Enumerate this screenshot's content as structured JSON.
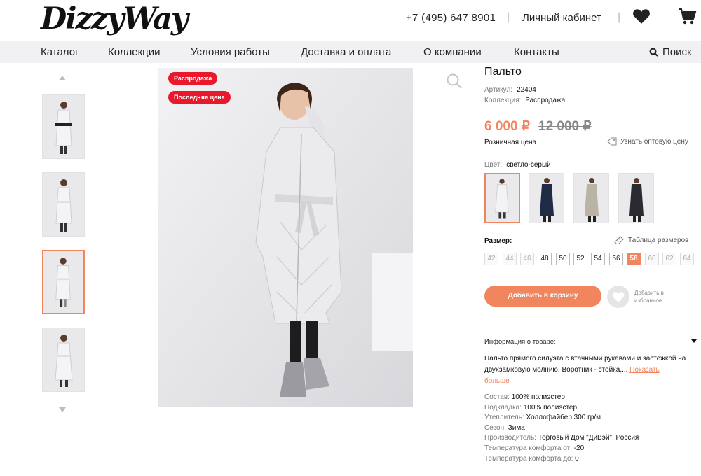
{
  "header": {
    "logo": "DizzyWay",
    "phone": "+7 (495) 647 8901",
    "separator": "|",
    "cabinet": "Личный кабинет"
  },
  "nav": {
    "items": [
      "Каталог",
      "Коллекции",
      "Условия работы",
      "Доставка и оплата",
      "О компании",
      "Контакты"
    ],
    "search": "Поиск"
  },
  "badges": [
    "Распродажа",
    "Последняя цена"
  ],
  "product": {
    "title": "Пальто",
    "article_label": "Артикул:",
    "article": "22404",
    "collection_label": "Коллекция:",
    "collection": "Распродажа",
    "price": "6 000 ₽",
    "old_price": "12 000 ₽",
    "retail_label": "Розничная цена",
    "wholesale_link": "Узнать оптовую цену",
    "color_label": "Цвет:",
    "color": "светло-серый",
    "size_label": "Размер:",
    "size_table": "Таблица размеров",
    "sizes": [
      "42",
      "44",
      "46",
      "48",
      "50",
      "52",
      "54",
      "56",
      "58",
      "60",
      "62",
      "64"
    ],
    "selected_size": "58",
    "add_to_cart": "Добавить в корзину",
    "favorite": "Добавить в избранное",
    "info_head": "Информация о товаре:",
    "description": "Пальто прямого силуэта с втачными рукавами и застежкой на двухзамковую молнию. Воротник - стойка,...",
    "show_more_1": "Показать",
    "show_more_2": "больше",
    "specs": [
      {
        "label": "Состав:",
        "value": "100% полиэстер"
      },
      {
        "label": "Подкладка:",
        "value": "100% полиэстер"
      },
      {
        "label": "Утеплитель:",
        "value": "Холлофайбер 300 гр/м"
      },
      {
        "label": "Сезон:",
        "value": "Зима"
      },
      {
        "label": "Производитель:",
        "value": "Торговый Дом \"ДиВэй\", Россия"
      },
      {
        "label": "Температура комфорта от:",
        "value": "-20"
      },
      {
        "label": "Температура комфорта до:",
        "value": "0"
      }
    ]
  },
  "colors": {
    "accent": "#f0855e",
    "badge": "#e8192c"
  }
}
